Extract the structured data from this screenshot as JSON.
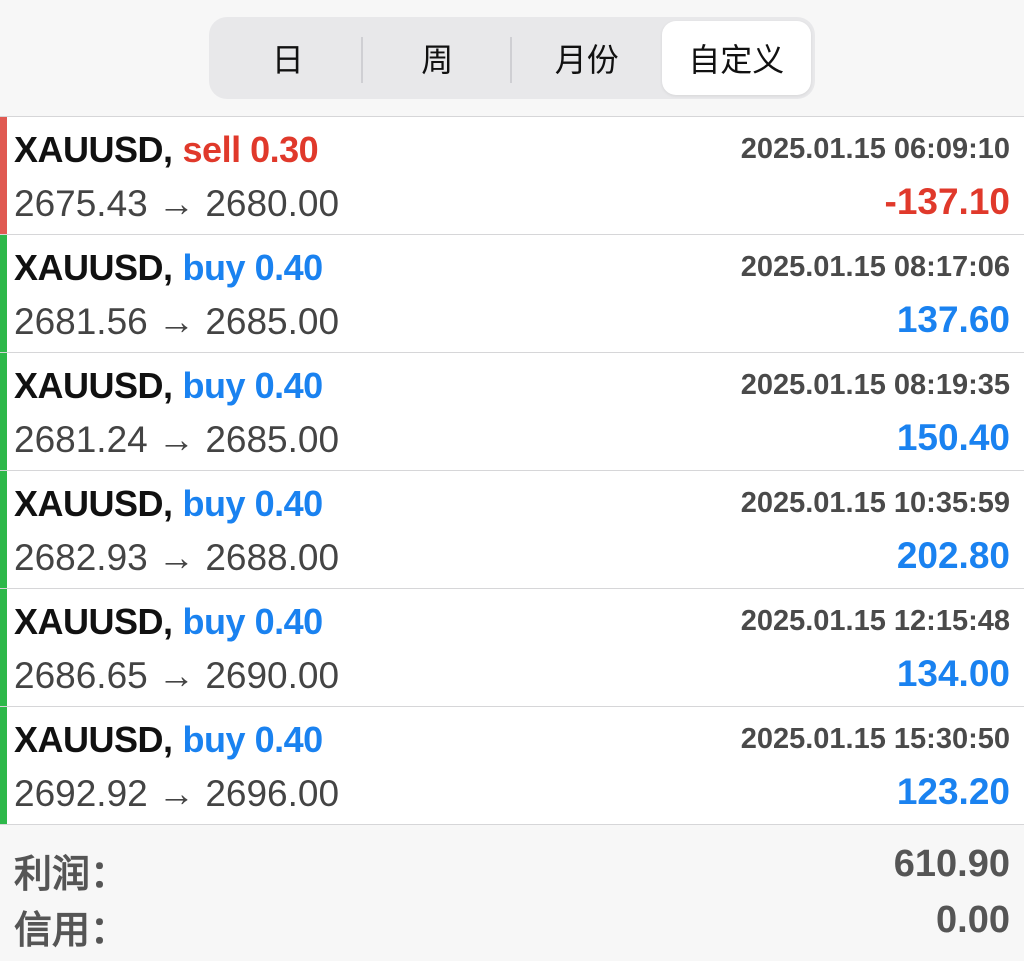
{
  "tabs": [
    {
      "label": "日",
      "active": false
    },
    {
      "label": "周",
      "active": false
    },
    {
      "label": "月份",
      "active": false
    },
    {
      "label": "自定义",
      "active": true
    }
  ],
  "colors": {
    "sell": "#e0392b",
    "buy": "#1a82f0",
    "sell_bar": "#e05a52",
    "buy_bar": "#2db84a",
    "loss": "#e0392b",
    "profit": "#1a82f0"
  },
  "trades": [
    {
      "symbol": "XAUUSD,",
      "side": "sell",
      "volume": "0.30",
      "open_price": "2675.43",
      "close_price": "2680.00",
      "time": "2025.01.15 06:09:10",
      "pl": "-137.10"
    },
    {
      "symbol": "XAUUSD,",
      "side": "buy",
      "volume": "0.40",
      "open_price": "2681.56",
      "close_price": "2685.00",
      "time": "2025.01.15 08:17:06",
      "pl": "137.60"
    },
    {
      "symbol": "XAUUSD,",
      "side": "buy",
      "volume": "0.40",
      "open_price": "2681.24",
      "close_price": "2685.00",
      "time": "2025.01.15 08:19:35",
      "pl": "150.40"
    },
    {
      "symbol": "XAUUSD,",
      "side": "buy",
      "volume": "0.40",
      "open_price": "2682.93",
      "close_price": "2688.00",
      "time": "2025.01.15 10:35:59",
      "pl": "202.80"
    },
    {
      "symbol": "XAUUSD,",
      "side": "buy",
      "volume": "0.40",
      "open_price": "2686.65",
      "close_price": "2690.00",
      "time": "2025.01.15 12:15:48",
      "pl": "134.00"
    },
    {
      "symbol": "XAUUSD,",
      "side": "buy",
      "volume": "0.40",
      "open_price": "2692.92",
      "close_price": "2696.00",
      "time": "2025.01.15 15:30:50",
      "pl": "123.20"
    }
  ],
  "summary": {
    "profit_label": "利润：",
    "profit_value": "610.90",
    "credit_label": "信用：",
    "credit_value": "0.00"
  }
}
